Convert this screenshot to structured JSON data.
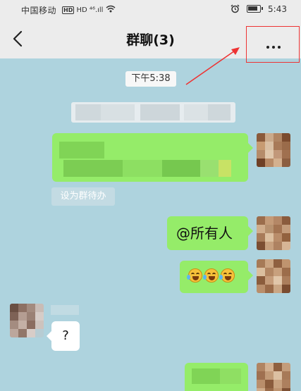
{
  "status_bar": {
    "carrier": "中国移动",
    "network": "HD ⁴⁶.ıll",
    "time": "5:43"
  },
  "header": {
    "title": "群聊(3)"
  },
  "chat": {
    "timestamp": "下午5:38",
    "todo_label": "设为群待办",
    "mention_text": "@所有人",
    "question_text": "?"
  },
  "icons": [
    "back-icon",
    "more-icon",
    "alarm-icon",
    "battery-icon",
    "wifi-icon",
    "emoji-laugh-cry-icon"
  ],
  "colors": {
    "chat_bg": "#aed3de",
    "sent_bubble": "#95ec69",
    "received_bubble": "#ffffff",
    "highlight": "#ee3333"
  }
}
